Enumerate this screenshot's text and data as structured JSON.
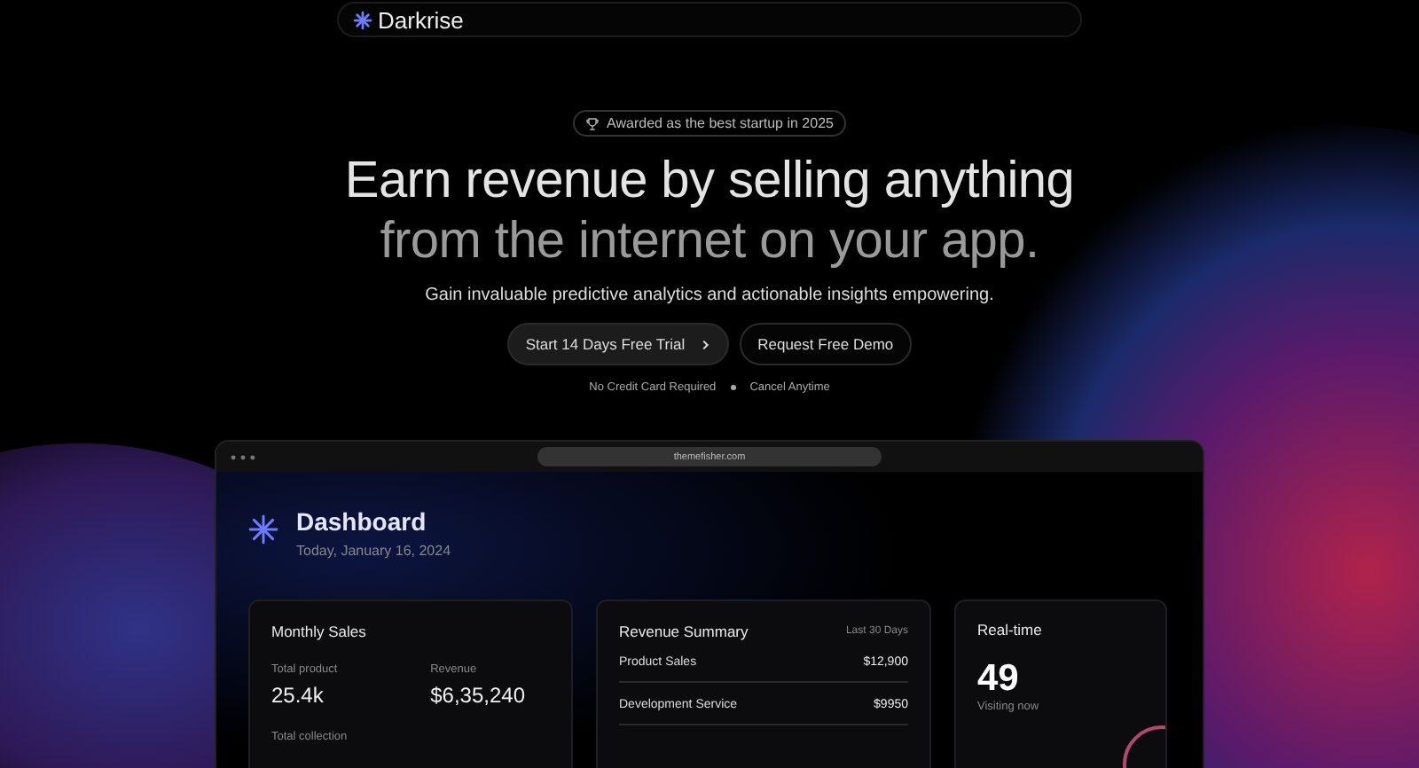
{
  "nav": {
    "brand": "Darkrise"
  },
  "hero": {
    "badge": "Awarded as the best startup in 2025",
    "title_line_1": "Earn revenue by selling anything",
    "title_line_2": "from the internet on your app.",
    "subtitle": "Gain invaluable predictive analytics and actionable insights empowering.",
    "buttons": [
      {
        "label": "Start 14 Days Free Trial",
        "kind": "primary"
      },
      {
        "label": "Request Free Demo",
        "kind": "secondary"
      }
    ],
    "notes": [
      "No Credit Card Required",
      "Cancel Anytime"
    ]
  },
  "browser": {
    "url": "themefisher.com"
  },
  "dashboard": {
    "title": "Dashboard",
    "date": "Today, January 16, 2024"
  },
  "monthly_sales": {
    "title": "Monthly Sales",
    "stats": [
      {
        "label": "Total product",
        "value": "25.4k"
      },
      {
        "label": "Revenue",
        "value": "$6,35,240"
      }
    ],
    "footer_label": "Total collection"
  },
  "revenue_summary": {
    "title": "Revenue Summary",
    "period": "Last 30 Days",
    "rows": [
      {
        "name": "Product Sales",
        "amount": "$12,900"
      },
      {
        "name": "Development Service",
        "amount": "$9950"
      }
    ]
  },
  "realtime": {
    "title": "Real-time",
    "count": "49",
    "caption": "Visiting now"
  }
}
